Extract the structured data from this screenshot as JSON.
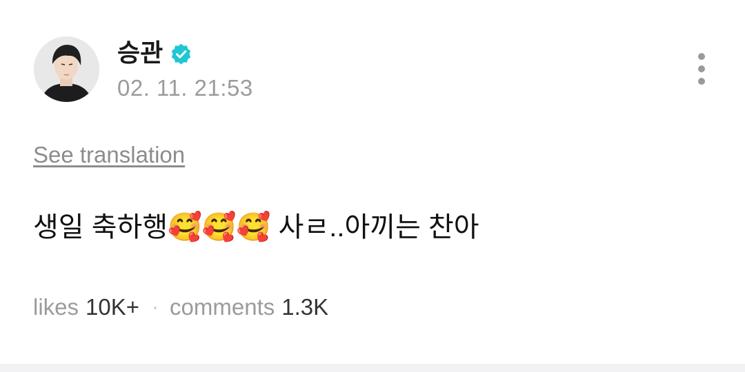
{
  "author": {
    "name": "승관",
    "verified_icon": "verified-badge-icon",
    "avatar_icon": "avatar-photo",
    "timestamp": "02. 11. 21:53"
  },
  "header": {
    "more_icon": "more-vertical-icon"
  },
  "post": {
    "translate_label": "See translation",
    "body": "생일 축하행🥰🥰🥰 사ㄹ..아끼는 찬아"
  },
  "stats": {
    "likes_label": "likes",
    "likes_value": "10K+",
    "separator": "·",
    "comments_label": "comments",
    "comments_value": "1.3K"
  },
  "colors": {
    "verified": "#1fc6d3",
    "muted_text": "#9b9b9b",
    "body_text": "#111111"
  }
}
